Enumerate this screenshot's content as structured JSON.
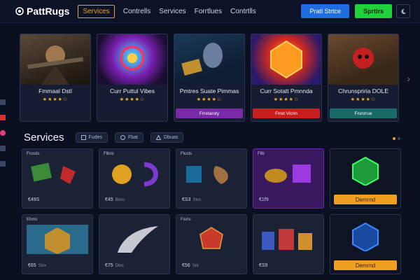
{
  "app": {
    "name": "PattRugs"
  },
  "nav": {
    "items": [
      {
        "label": "Services",
        "active": true
      },
      {
        "label": "Contrells"
      },
      {
        "label": "Services"
      },
      {
        "label": "Forrtlues"
      },
      {
        "label": "Contrtlls"
      }
    ]
  },
  "header": {
    "primary_button": "Pratl Strtce",
    "secondary_button": "Sprtirs",
    "theme_icon": "moon-icon"
  },
  "featured": [
    {
      "title": "Fmmaal Dstl",
      "stars": "★★★★☆",
      "badge": ""
    },
    {
      "title": "Curr Puttul Vibes",
      "stars": "★★★★☆",
      "badge": ""
    },
    {
      "title": "Pmtres Suate Pimmas",
      "stars": "★★★★☆",
      "badge": "Frretaroty"
    },
    {
      "title": "Curr Sotatt Pmnnda",
      "stars": "★★★★☆",
      "badge": "Frret Vicrin"
    },
    {
      "title": "Chrunspriria DOLE",
      "stars": "★★★★☆",
      "badge": "Fronrrue"
    }
  ],
  "services_section": {
    "title": "Services",
    "filters": [
      "Fudes",
      "Fbat",
      "Dbuas"
    ]
  },
  "services": [
    {
      "tag": "Frusds",
      "price": "€49S",
      "sub": ""
    },
    {
      "tag": "Flbris",
      "price": "€45",
      "sub": "Bbvs"
    },
    {
      "tag": "Flucts",
      "price": "€S3",
      "sub": "Stvx"
    },
    {
      "tag": "Fllb",
      "price": "€1f9",
      "sub": ""
    },
    {
      "tag": "",
      "price": "",
      "sub": "",
      "button": "Demrnd"
    },
    {
      "tag": "Ehms",
      "price": "€65",
      "sub": "Slvx"
    },
    {
      "tag": "",
      "price": "€75",
      "sub": "Dbls"
    },
    {
      "tag": "Fisrts",
      "price": "€56",
      "sub": "Srk"
    },
    {
      "tag": "",
      "price": "€S9",
      "sub": ""
    },
    {
      "tag": "",
      "price": "",
      "sub": "",
      "button": "Demrnd"
    }
  ],
  "colors": {
    "accent": "#f0a020",
    "primary": "#1f6de0",
    "success": "#1fd13a",
    "bg": "#0b1020"
  }
}
